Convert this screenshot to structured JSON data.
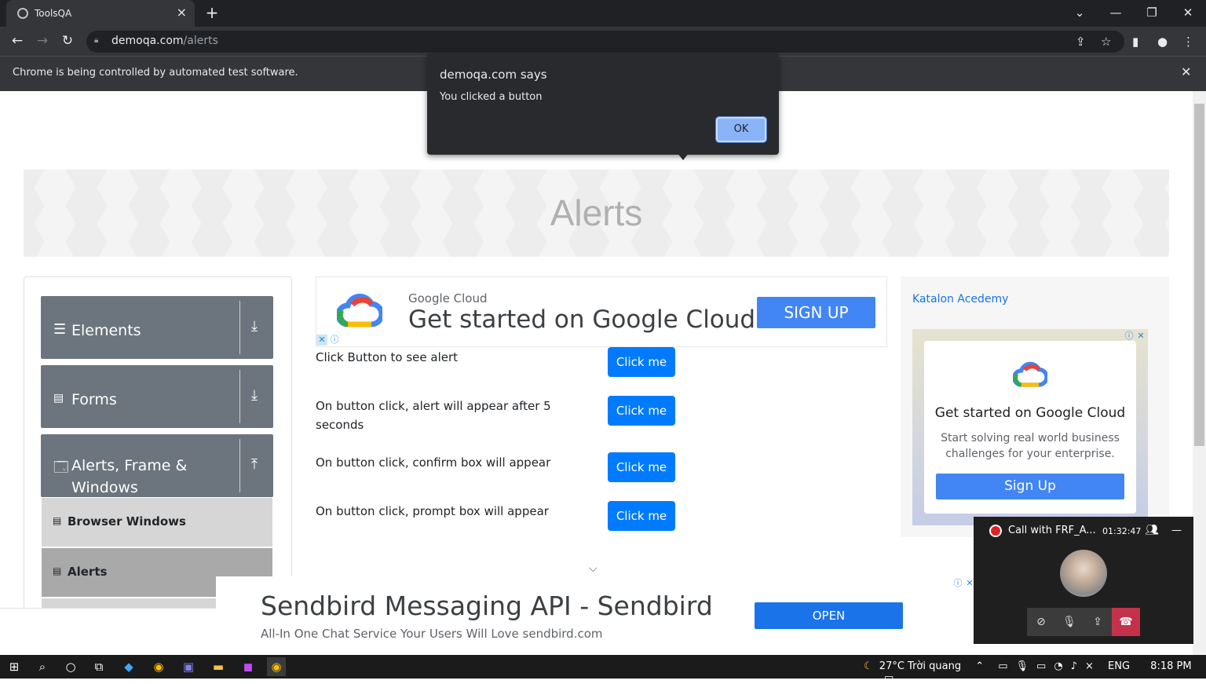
{
  "browser": {
    "tab_title": "ToolsQA",
    "url_domain": "demoqa.com",
    "url_path": "/alerts",
    "infobar_text": "Chrome is being controlled by automated test software."
  },
  "dialog": {
    "title": "demoqa.com says",
    "message": "You clicked a button",
    "ok_label": "OK"
  },
  "page": {
    "title": "Alerts"
  },
  "sidebar": {
    "groups": [
      {
        "label": "Elements"
      },
      {
        "label": "Forms"
      },
      {
        "label": "Alerts, Frame & Windows"
      }
    ],
    "items": [
      {
        "label": "Browser Windows"
      },
      {
        "label": "Alerts"
      }
    ]
  },
  "ad_top": {
    "brand": "Google Cloud",
    "headline": "Get started on Google Cloud",
    "button": "SIGN UP"
  },
  "alert_rows": [
    {
      "label": "Click Button to see alert",
      "button": "Click me"
    },
    {
      "label": "On button click, alert will appear after 5 seconds",
      "button": "Click me"
    },
    {
      "label": "On button click, confirm box will appear",
      "button": "Click me"
    },
    {
      "label": "On button click, prompt box will appear",
      "button": "Click me"
    }
  ],
  "ad_right": {
    "image_alt": "Katalon Acedemy",
    "headline": "Get started on Google Cloud",
    "subtext": "Start solving real world business challenges for your enterprise.",
    "button": "Sign Up"
  },
  "ad_bottom": {
    "headline": "Sendbird Messaging API - Sendbird",
    "subtext": "All-In One Chat Service Your Users Will Love sendbird.com",
    "button": "OPEN"
  },
  "call_widget": {
    "title": "Call with FRF_A...",
    "elapsed": "01:32:47"
  },
  "taskbar": {
    "weather": "27°C  Trời quang",
    "language": "ENG",
    "time": "8:18 PM"
  }
}
